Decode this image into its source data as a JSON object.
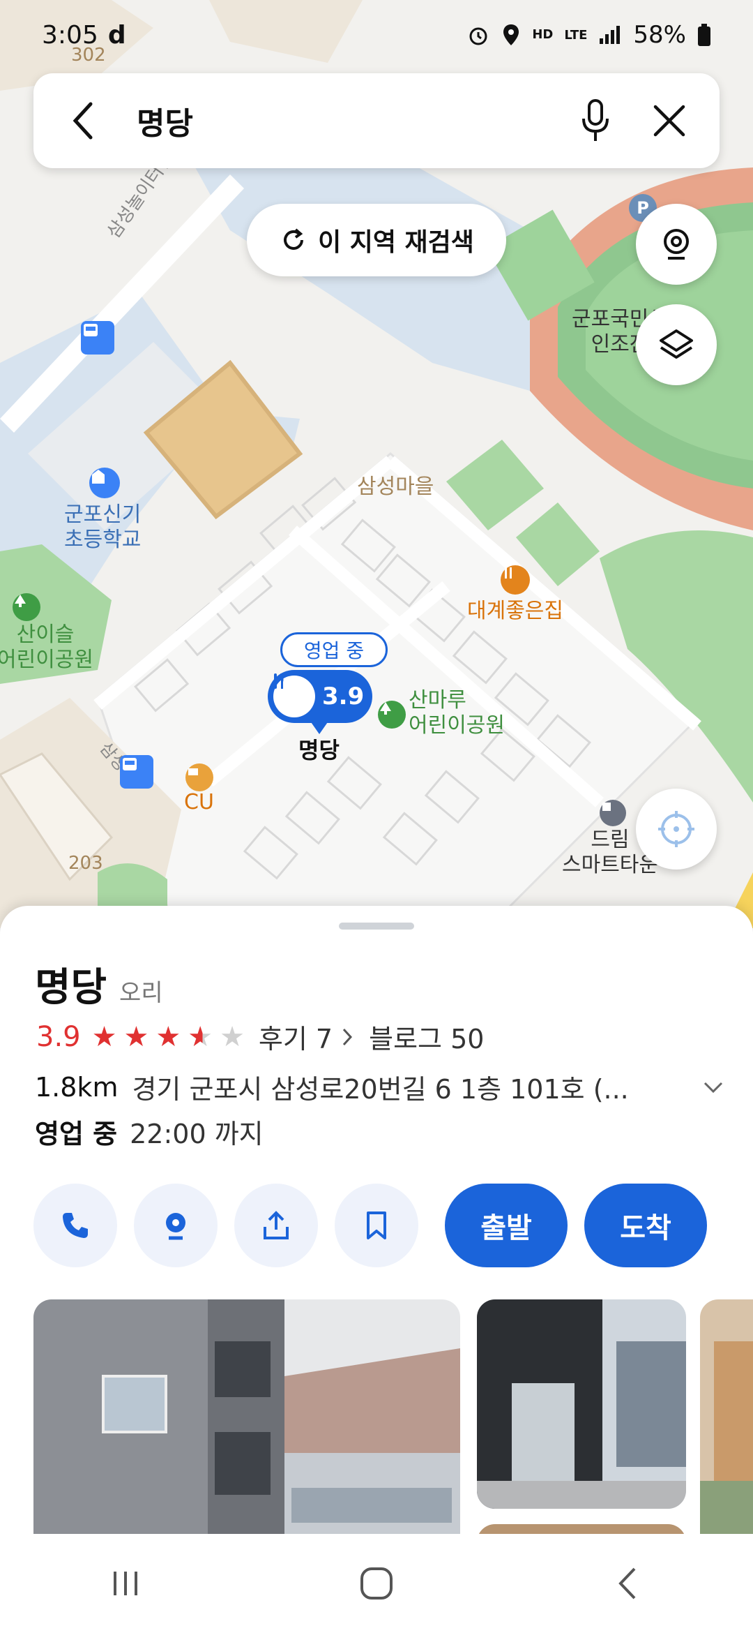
{
  "status_bar": {
    "time": "3:05",
    "carrier_icon": "d",
    "network": "LTE",
    "hd": "HD",
    "battery": "58%"
  },
  "search": {
    "query": "명당"
  },
  "map": {
    "research_label": "이 지역 재검색",
    "labels": {
      "road_top": "302",
      "road_bottom": "203",
      "school": "군포신기\n초등학교",
      "village": "삼성마을",
      "restaurant2": "대계좋은집",
      "park1": "산이슬\n어린이공원",
      "park2": "산마루\n어린이공원",
      "center": "군포국민센터\n인조잔디",
      "dream": "드림\n스마트타운",
      "cu": "CU",
      "road_name": "삼성놀이터길",
      "road_name2": "삼성"
    },
    "marker": {
      "open_chip": "영업 중",
      "rating": "3.9",
      "name": "명당"
    }
  },
  "place": {
    "name": "명당",
    "category": "오리",
    "rating": "3.9",
    "rating_value": 3.9,
    "reviews": "후기 7",
    "blogs": "블로그 50",
    "distance": "1.8km",
    "address": "경기 군포시 삼성로20번길 6 1층 101호 (...",
    "open_status": "영업 중",
    "hours": "22:00 까지"
  },
  "actions": {
    "depart": "출발",
    "arrive": "도착"
  },
  "icons": {
    "back": "back-arrow-icon",
    "mic": "microphone-icon",
    "close": "close-icon",
    "refresh": "refresh-icon",
    "cctv": "cctv-icon",
    "layers": "layers-icon",
    "locate": "locate-icon",
    "phone": "phone-icon",
    "pin": "location-pin-icon",
    "share": "share-icon",
    "bookmark": "bookmark-icon"
  },
  "colors": {
    "accent": "#1b64da",
    "rating": "#e03131"
  }
}
